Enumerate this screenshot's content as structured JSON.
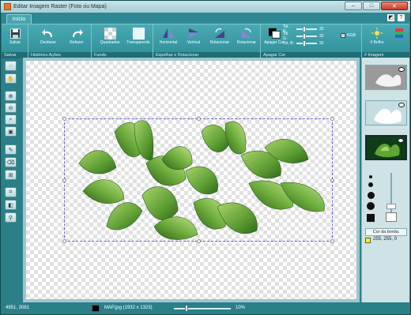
{
  "window": {
    "title": "Editar Imagem Raster (Foto ou Mapa)",
    "buttons": {
      "minimize": "–",
      "maximize": "□",
      "close": "✕"
    }
  },
  "tabs": [
    {
      "label": "Início",
      "active": true
    }
  ],
  "help_icons": [
    "palette-icon",
    "help-icon"
  ],
  "ribbon": {
    "groups": [
      {
        "name": "Salvar",
        "buttons": [
          {
            "label": "Salvar",
            "icon": "floppy-icon"
          }
        ]
      },
      {
        "name": "Histórico Ações",
        "buttons": [
          {
            "label": "Desfazer",
            "icon": "undo-icon"
          },
          {
            "label": "Refazer",
            "icon": "redo-icon"
          }
        ]
      },
      {
        "name": "Fundo",
        "buttons": [
          {
            "label": "Quadrados",
            "icon": "checker-icon"
          },
          {
            "label": "Transparente",
            "icon": "transparent-icon"
          }
        ]
      },
      {
        "name": "Espelhar e Rotacionar",
        "buttons": [
          {
            "label": "Horizontal",
            "icon": "flip-horizontal-icon"
          },
          {
            "label": "Vertical",
            "icon": "flip-vertical-icon"
          },
          {
            "label": "Rotacionar",
            "icon": "rotate-left-icon"
          },
          {
            "label": "Rotacionar",
            "icon": "rotate-right-icon"
          }
        ]
      },
      {
        "name": "Apagar Cor",
        "buttons": [
          {
            "label": "Apagar Cor",
            "icon": "erase-color-icon"
          }
        ],
        "tolerances": [
          {
            "label": "Tol. R:",
            "value": "32",
            "level": 0.35
          },
          {
            "label": "Tol. G:",
            "value": "32",
            "level": 0.35
          },
          {
            "label": "Tol. B:",
            "value": "32",
            "level": 0.35
          }
        ],
        "rgb_checkbox": {
          "label": "RGB",
          "checked": true
        }
      },
      {
        "name": "# Imagem",
        "buttons": [
          {
            "label": "# Brilho",
            "icon": "brightness-icon"
          },
          {
            "label": "",
            "icon": "contrast-icon"
          }
        ]
      }
    ]
  },
  "left_tools": [
    "lasso-icon",
    "hand-icon",
    "zoom-in-icon",
    "zoom-out-icon",
    "zoom-fit-icon",
    "zoom-100-icon",
    "pencil-icon",
    "eraser-icon",
    "stamp-icon",
    "crop-icon",
    "fill-icon",
    "eyedropper-icon"
  ],
  "right_panel": {
    "layers": [
      {
        "name": "layer-mask-gray",
        "visible": true
      },
      {
        "name": "layer-mask-white",
        "visible": true
      },
      {
        "name": "layer-original",
        "visible": true
      }
    ],
    "brush_sizes": [
      "tiny",
      "small",
      "medium",
      "large",
      "square"
    ],
    "border_color_label": "Cor da borda:",
    "border_color_value": "255, 255, 0",
    "border_color": "#ffff00"
  },
  "status": {
    "coords": "4951, 3081",
    "file_info": "MAP.jpg (1932 x 1323)",
    "zoom": "10%",
    "zoom_level": 0.2
  },
  "colors": {
    "accent": "#2a7f89",
    "selection": "#6b5fcf"
  }
}
